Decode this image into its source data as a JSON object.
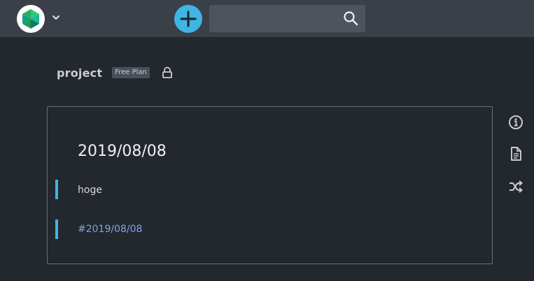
{
  "header": {
    "search": {
      "placeholder": "",
      "value": ""
    }
  },
  "project": {
    "name": "project",
    "plan_badge": "Free Plan"
  },
  "page": {
    "title": "2019/08/08",
    "lines": [
      {
        "text": "hoge",
        "type": "text"
      },
      {
        "text": "#2019/08/08",
        "type": "link"
      }
    ]
  },
  "icons": {
    "logo": "logo-icon",
    "caret": "chevron-down-icon",
    "add": "plus-icon",
    "search": "search-icon",
    "lock": "lock-icon",
    "info": "info-icon",
    "document": "document-icon",
    "shuffle": "shuffle-icon"
  },
  "colors": {
    "accent": "#3fb5e6",
    "link": "#7aa7e6",
    "background": "#23272e",
    "topbar": "#3a3f48"
  }
}
